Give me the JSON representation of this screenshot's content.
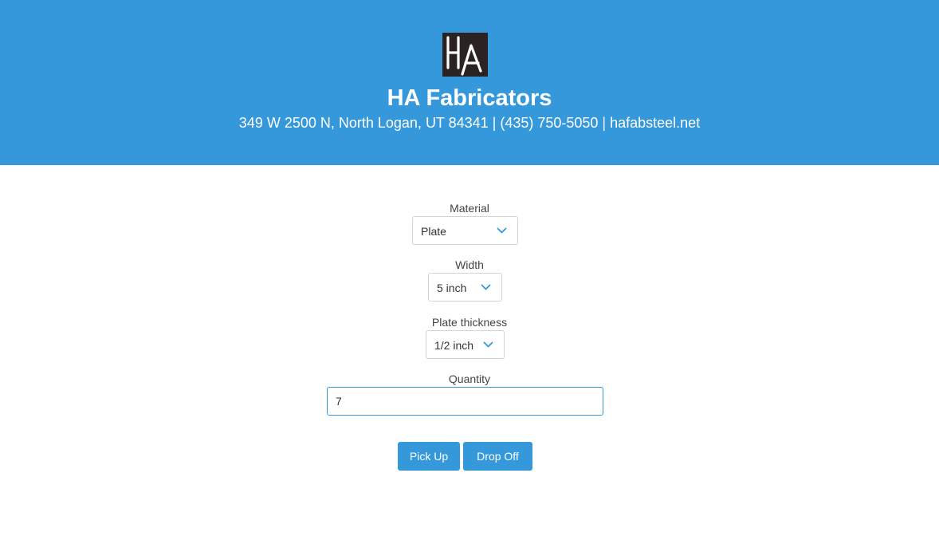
{
  "header": {
    "logo_text": "HA",
    "company_name": "HA Fabricators",
    "company_info": "349 W 2500 N, North Logan, UT 84341 | (435) 750-5050 | hafabsteel.net",
    "background_color": "#3498db"
  },
  "form": {
    "material": {
      "label": "Material",
      "value": "Plate",
      "icon": "chevron-down-icon"
    },
    "width": {
      "label": "Width",
      "value": "5 inch",
      "icon": "chevron-down-icon"
    },
    "thickness": {
      "label": "Plate thickness",
      "value": "1/2 inch",
      "icon": "chevron-down-icon"
    },
    "quantity": {
      "label": "Quantity",
      "value": "7"
    }
  },
  "buttons": {
    "pick_up": "Pick Up",
    "drop_off": "Drop Off"
  },
  "colors": {
    "accent": "#3498db",
    "text": "#333333",
    "border": "#d4d4d4"
  }
}
